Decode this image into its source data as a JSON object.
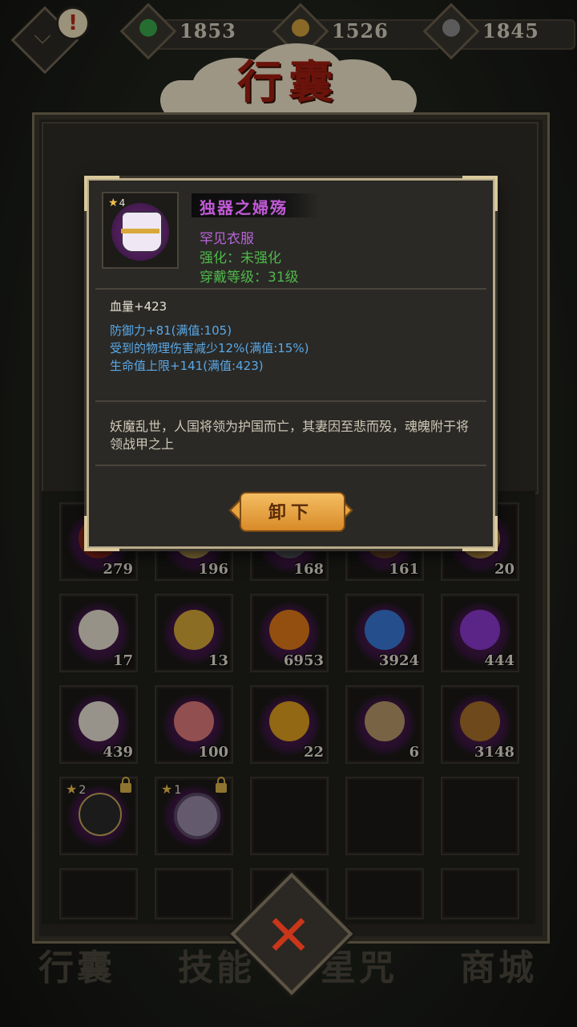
{
  "resources": [
    {
      "icon": "leaf-gem-icon",
      "color": "#3aa84a",
      "value": "1853"
    },
    {
      "icon": "coin-icon",
      "color": "#d2a23c",
      "value": "1526"
    },
    {
      "icon": "soul-icon",
      "color": "#8c8c8c",
      "value": "1845"
    }
  ],
  "title": "行囊",
  "popup": {
    "item_name": "独器之婦殇",
    "rarity": "罕见衣服",
    "enhance": "强化：未强化",
    "level_req": "穿戴等级：31级",
    "star": "4",
    "base_stat": "血量+423",
    "stats": [
      "防御力+81(满值:105)",
      "受到的物理伤害减少12%(满值:15%)",
      "生命值上限+141(满值:423)"
    ],
    "description": "妖魔乱世，人国将领为护国而亡，其妻因至悲而殁，魂魄附于将领战甲之上",
    "unequip_label": "卸下"
  },
  "colors": {
    "rarity": "#b765d6",
    "enhance": "#4fb84a",
    "stat_blue": "#5aa8e6",
    "base_stat": "#e8e2d4"
  },
  "grid": [
    [
      {
        "count": "279",
        "art": "#9c2a20"
      },
      {
        "count": "196",
        "art": "#c8a858"
      },
      {
        "count": "168",
        "art": "#5a5e66"
      },
      {
        "count": "161",
        "art": "#7a4a2a"
      },
      {
        "count": "20",
        "art": "#c89a48"
      }
    ],
    [
      {
        "count": "17",
        "art": "#e8e0d0"
      },
      {
        "count": "13",
        "art": "#d8a838"
      },
      {
        "count": "6953",
        "art": "#e07a1a"
      },
      {
        "count": "3924",
        "art": "#3a7ad8"
      },
      {
        "count": "444",
        "art": "#8a3ad0"
      }
    ],
    [
      {
        "count": "439",
        "art": "#e8e2d4"
      },
      {
        "count": "100",
        "art": "#e07a7a"
      },
      {
        "count": "22",
        "art": "#e0a020"
      },
      {
        "count": "6",
        "art": "#b89a6a"
      },
      {
        "count": "3148",
        "art": "#a8702a"
      }
    ],
    [
      {
        "count": "",
        "star": "2",
        "locked": true,
        "art": "#2a2a2a"
      },
      {
        "count": "",
        "star": "1",
        "locked": true,
        "art": "#9a8aa8"
      },
      {
        "count": ""
      },
      {
        "count": ""
      },
      {
        "count": ""
      }
    ],
    [
      {
        "count": ""
      },
      {
        "count": ""
      },
      {
        "count": ""
      },
      {
        "count": ""
      },
      {
        "count": ""
      }
    ]
  ],
  "bottom_nav": [
    "行囊",
    "技能",
    "星咒",
    "商城"
  ]
}
